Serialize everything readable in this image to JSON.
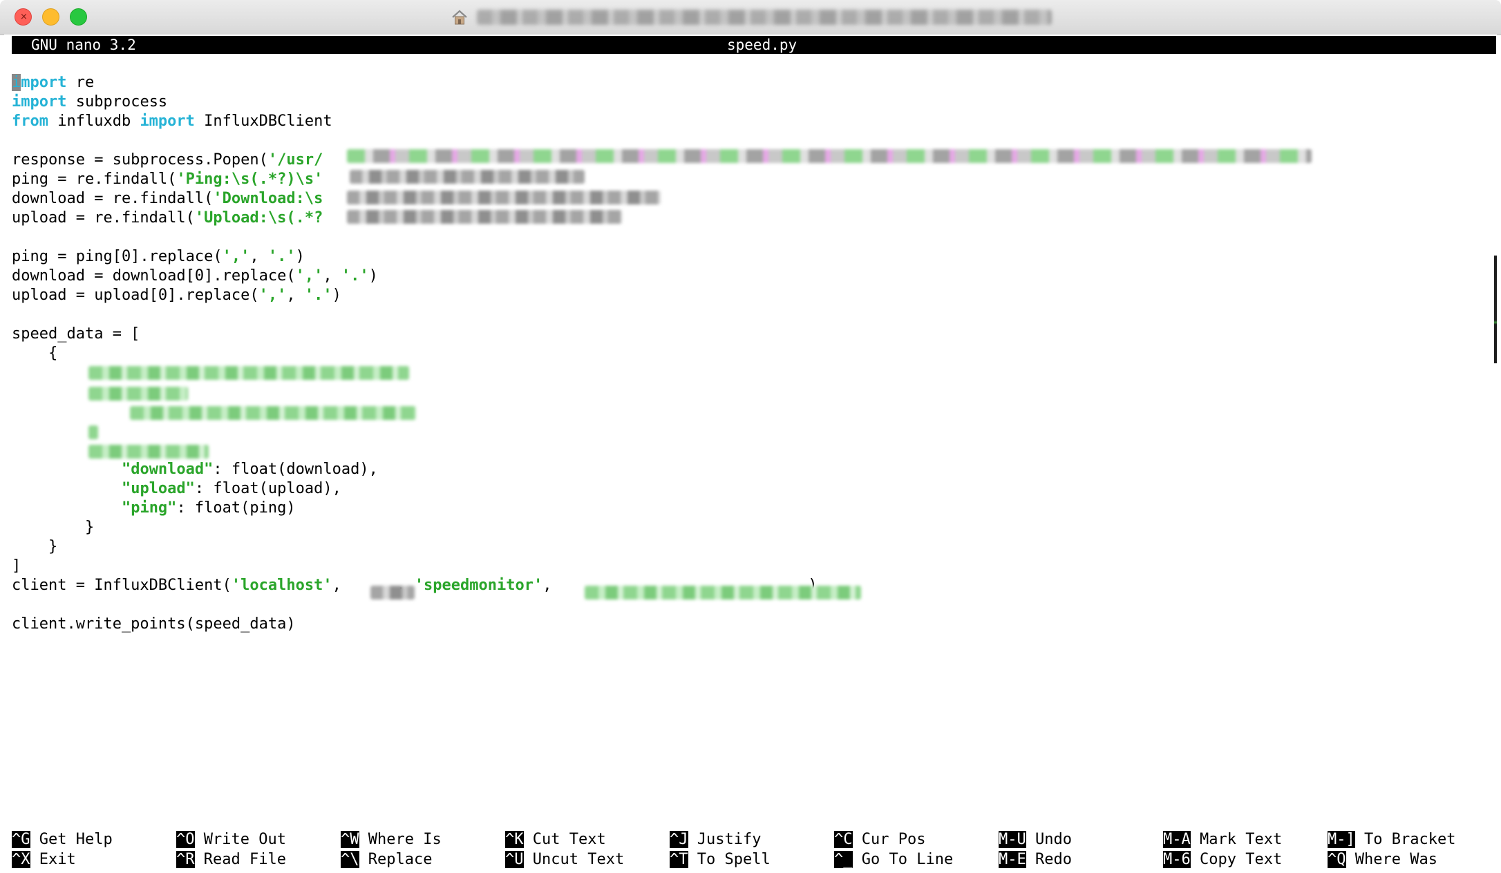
{
  "window": {
    "app": "GNU nano 3.2",
    "filename": "speed.py"
  },
  "code": [
    [
      {
        "t": "i",
        "c": "cursor"
      },
      {
        "t": "mport",
        "c": "kw"
      },
      {
        "t": " re"
      }
    ],
    [
      {
        "t": "import",
        "c": "kw"
      },
      {
        "t": " subprocess"
      }
    ],
    [
      {
        "t": "from",
        "c": "kw"
      },
      {
        "t": " influxdb "
      },
      {
        "t": "import",
        "c": "kw"
      },
      {
        "t": " InfluxDBClient"
      }
    ],
    [],
    [
      {
        "t": "response = subprocess.Popen("
      },
      {
        "t": "'/usr/",
        "c": "str"
      }
    ],
    [
      {
        "t": "ping = re.findall("
      },
      {
        "t": "'Ping:\\s(.*?)\\s'",
        "c": "str"
      }
    ],
    [
      {
        "t": "download = re.findall("
      },
      {
        "t": "'Download:\\s",
        "c": "str"
      }
    ],
    [
      {
        "t": "upload = re.findall("
      },
      {
        "t": "'Upload:\\s(.*?",
        "c": "str"
      }
    ],
    [],
    [
      {
        "t": "ping = ping[0].replace("
      },
      {
        "t": "','",
        "c": "str"
      },
      {
        "t": ", "
      },
      {
        "t": "'.'",
        "c": "str"
      },
      {
        "t": ")"
      }
    ],
    [
      {
        "t": "download = download[0].replace("
      },
      {
        "t": "','",
        "c": "str"
      },
      {
        "t": ", "
      },
      {
        "t": "'.'",
        "c": "str"
      },
      {
        "t": ")"
      }
    ],
    [
      {
        "t": "upload = upload[0].replace("
      },
      {
        "t": "','",
        "c": "str"
      },
      {
        "t": ", "
      },
      {
        "t": "'.'",
        "c": "str"
      },
      {
        "t": ")"
      }
    ],
    [],
    [
      {
        "t": "speed_data = ["
      }
    ],
    [
      {
        "t": "    {"
      }
    ],
    [],
    [],
    [],
    [],
    [],
    [
      {
        "t": "            "
      },
      {
        "t": "\"download\"",
        "c": "str"
      },
      {
        "t": ": float(download),"
      }
    ],
    [
      {
        "t": "            "
      },
      {
        "t": "\"upload\"",
        "c": "str"
      },
      {
        "t": ": float(upload),"
      }
    ],
    [
      {
        "t": "            "
      },
      {
        "t": "\"ping\"",
        "c": "str"
      },
      {
        "t": ": float(ping)"
      }
    ],
    [
      {
        "t": "        }"
      }
    ],
    [
      {
        "t": "    }"
      }
    ],
    [
      {
        "t": "]"
      }
    ],
    [
      {
        "t": "client = InfluxDBClient("
      },
      {
        "t": "'localhost'",
        "c": "str"
      },
      {
        "t": ",      , "
      },
      {
        "t": "'speedmonitor'",
        "c": "str"
      },
      {
        "t": ",                            )"
      }
    ],
    [],
    [
      {
        "t": "client.write_points(speed_data)"
      }
    ]
  ],
  "shortcuts": [
    {
      "key1": "^G",
      "label1": "Get Help",
      "key2": "^X",
      "label2": "Exit"
    },
    {
      "key1": "^O",
      "label1": "Write Out",
      "key2": "^R",
      "label2": "Read File"
    },
    {
      "key1": "^W",
      "label1": "Where Is",
      "key2": "^\\",
      "label2": "Replace"
    },
    {
      "key1": "^K",
      "label1": "Cut Text",
      "key2": "^U",
      "label2": "Uncut Text"
    },
    {
      "key1": "^J",
      "label1": "Justify",
      "key2": "^T",
      "label2": "To Spell"
    },
    {
      "key1": "^C",
      "label1": "Cur Pos",
      "key2": "^_",
      "label2": "Go To Line"
    },
    {
      "key1": "M-U",
      "label1": "Undo",
      "key2": "M-E",
      "label2": "Redo"
    },
    {
      "key1": "M-A",
      "label1": "Mark Text",
      "key2": "M-6",
      "label2": "Copy Text"
    },
    {
      "key1": "M-]",
      "label1": "To Bracket",
      "key2": "^Q",
      "label2": "Where Was"
    }
  ]
}
